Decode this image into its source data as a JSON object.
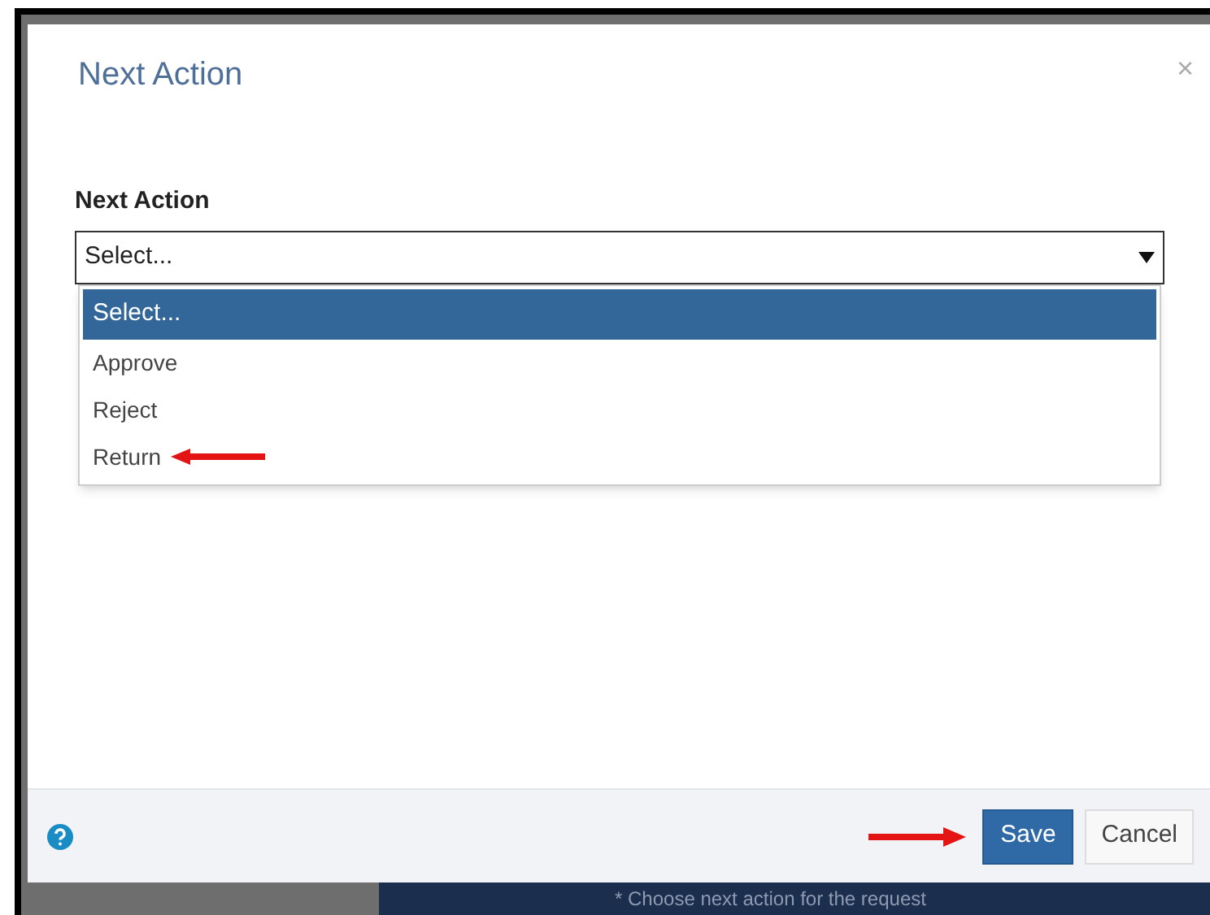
{
  "dialog": {
    "title": "Next Action",
    "close": "×",
    "field": {
      "label": "Next Action",
      "value": "Select...",
      "options": [
        {
          "label": "Select...",
          "selected": true
        },
        {
          "label": "Approve",
          "selected": false
        },
        {
          "label": "Reject",
          "selected": false
        },
        {
          "label": "Return",
          "selected": false
        }
      ]
    },
    "buttons": [
      {
        "label": "Save",
        "kind": "primary"
      },
      {
        "label": "Cancel",
        "kind": "secondary"
      }
    ]
  },
  "background_hint": "* Choose next action for the request"
}
